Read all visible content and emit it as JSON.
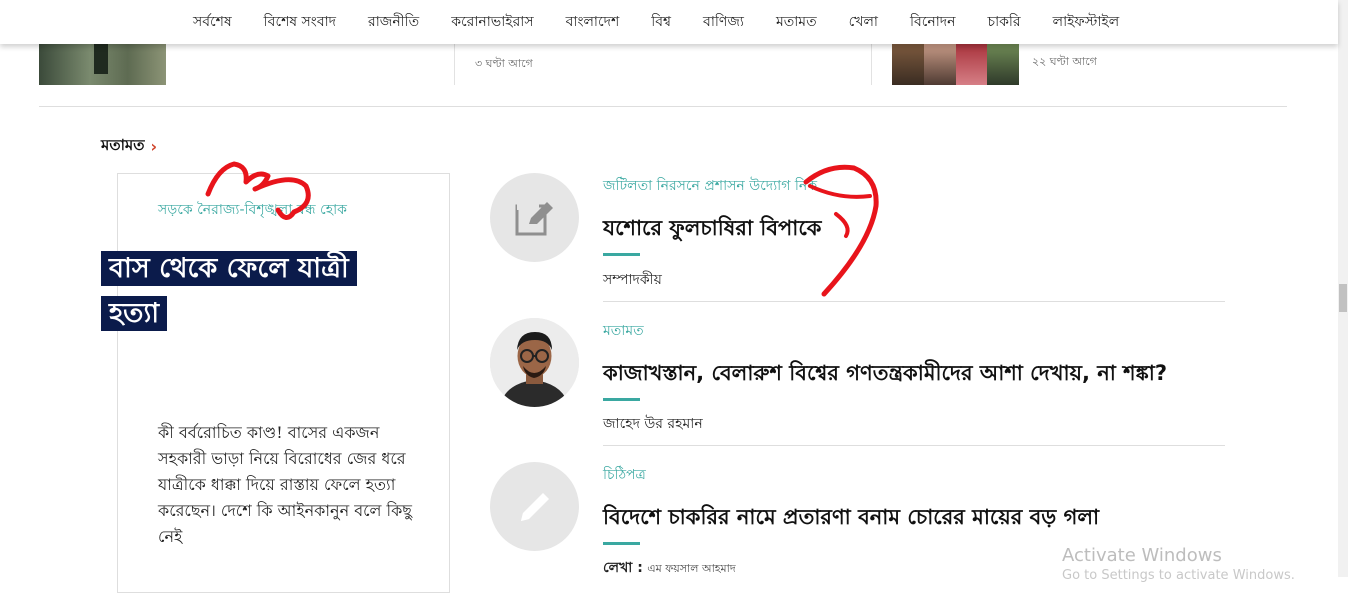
{
  "nav": {
    "items": [
      "সর্বশেষ",
      "বিশেষ সংবাদ",
      "রাজনীতি",
      "করোনাভাইরাস",
      "বাংলাদেশ",
      "বিশ্ব",
      "বাণিজ্য",
      "মতামত",
      "খেলা",
      "বিনোদন",
      "চাকরি",
      "লাইফস্টাইল"
    ]
  },
  "prev_strip": {
    "time_2": "৩ ঘণ্টা আগে",
    "time_3": "২২ ঘণ্টা আগে"
  },
  "section": {
    "title": "মতামত",
    "chevron": "›"
  },
  "featured": {
    "kicker": "সড়কে নৈরাজ্য-বিশৃঙ্খলা বন্ধ হোক",
    "title": "বাস থেকে ফেলে যাত্রী হত্যা",
    "body": "কী বর্বরোচিত কাণ্ড! বাসের একজন সহকারী ভাড়া নিয়ে বিরোধের জের ধরে যাত্রীকে ধাক্কা দিয়ে রাস্তায় ফেলে হত্যা করেছেন। দেশে কি আইনকানুন বলে কিছু নেই"
  },
  "items": [
    {
      "kicker": "জটিলতা নিরসনে প্রশাসন উদ্যোগ নিক",
      "headline": "যশোরে ফুলচাষিরা বিপাকে",
      "author": "সম্পাদকীয়",
      "icon": "edit-icon"
    },
    {
      "kicker": "মতামত",
      "headline": "কাজাখস্তান, বেলারুশ বিশ্বের গণতন্ত্রকামীদের আশা দেখায়, না শঙ্কা?",
      "author": "জাহেদ উর রহমান",
      "icon": "author-photo"
    },
    {
      "kicker": "চিঠিপত্র",
      "headline": "বিদেশে চাকরির নামে প্রতারণা বনাম চোরের মায়ের বড় গলা",
      "author_label": "লেখা :",
      "author": "এম ফয়সাল আহমাদ",
      "icon": "pencil-icon"
    }
  ],
  "watermark": {
    "line1": "Activate Windows",
    "line2": "Go to Settings to activate Windows."
  },
  "colors": {
    "accent": "#3aa8a1",
    "title_bg": "#0b1b4b",
    "chevron": "#d0452d",
    "scribble": "#e8141b"
  }
}
